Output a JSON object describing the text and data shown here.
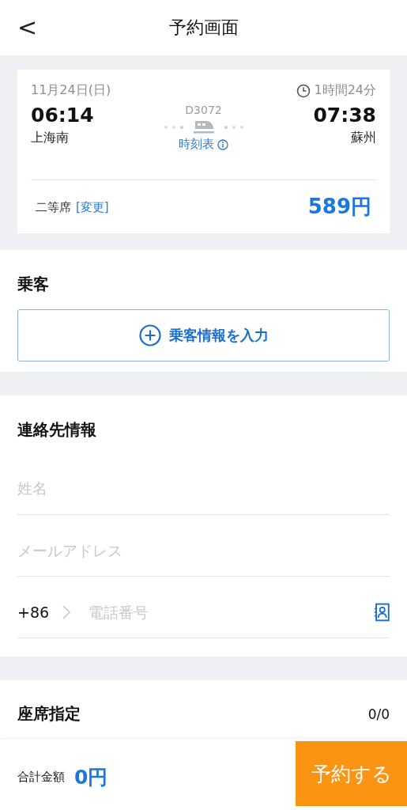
{
  "header": {
    "back": "<",
    "title": "予約画面"
  },
  "trip": {
    "date": "11月24日(日)",
    "duration": "1時間24分",
    "train": "D3072",
    "depart_time": "06:14",
    "depart_station": "上海南",
    "arrive_time": "07:38",
    "arrive_station": "蘇州",
    "timetable": "時刻表",
    "seat_class": "二等席",
    "change": "[変更]",
    "price": "589円"
  },
  "passenger": {
    "title": "乗客",
    "add_button": "乗客情報を入力"
  },
  "contact": {
    "title": "連絡先情報",
    "name_placeholder": "姓名",
    "email_placeholder": "メールアドレス",
    "country_code": "+86",
    "phone_placeholder": "電話番号"
  },
  "seat": {
    "title": "座席指定",
    "count": "0/0"
  },
  "footer": {
    "total_label": "合計金額",
    "total": "0円",
    "book_button": "予約する"
  }
}
